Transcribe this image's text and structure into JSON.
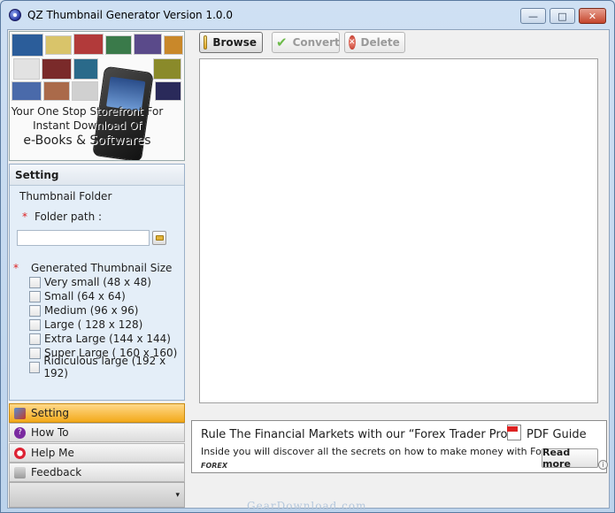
{
  "window": {
    "title": "QZ Thumbnail Generator Version 1.0.0",
    "buttons": {
      "minimize": "—",
      "maximize": "□",
      "close": "✕"
    }
  },
  "banner": {
    "line1": "Your One Stop Storefront For",
    "line2": "Instant Download Of",
    "line3": "e-Books & Softwares"
  },
  "setting": {
    "header": "Setting",
    "thumbnail_folder_label": "Thumbnail Folder",
    "required_marker": "*",
    "folder_path_label": "Folder path :",
    "folder_path_value": "",
    "size_label": "Generated Thumbnail Size",
    "sizes": [
      {
        "label": "Very small (48 x 48)",
        "checked": false
      },
      {
        "label": "Small (64 x 64)",
        "checked": false
      },
      {
        "label": "Medium (96 x 96)",
        "checked": false
      },
      {
        "label": "Large ( 128 x 128)",
        "checked": false
      },
      {
        "label": "Extra Large (144 x 144)",
        "checked": false
      },
      {
        "label": "Super Large ( 160 x 160)",
        "checked": false
      },
      {
        "label": "Ridiculous large (192 x 192)",
        "checked": false
      }
    ]
  },
  "nav": {
    "items": [
      {
        "label": "Setting",
        "active": true
      },
      {
        "label": "How To",
        "active": false
      },
      {
        "label": "Help Me",
        "active": false
      },
      {
        "label": "Feedback",
        "active": false
      }
    ],
    "overflow_icon": "▾"
  },
  "toolbar": {
    "browse_label": "Browse",
    "convert_label": "Convert",
    "delete_label": "Delete"
  },
  "ad": {
    "title": "Rule The Financial Markets with our “Forex Trader Pro”",
    "pdf_guide": "PDF Guide",
    "pdf_badge": "PDF",
    "body": "Inside you will discover all the secrets on how to make money with Forex.",
    "logo": "FOREX",
    "read_more": "Read more",
    "info": "i"
  },
  "watermark": "GearDownload.com",
  "colors": {
    "active_nav": "#f3a91a",
    "panel_bg": "#e4eef8",
    "required": "#dd2222"
  }
}
